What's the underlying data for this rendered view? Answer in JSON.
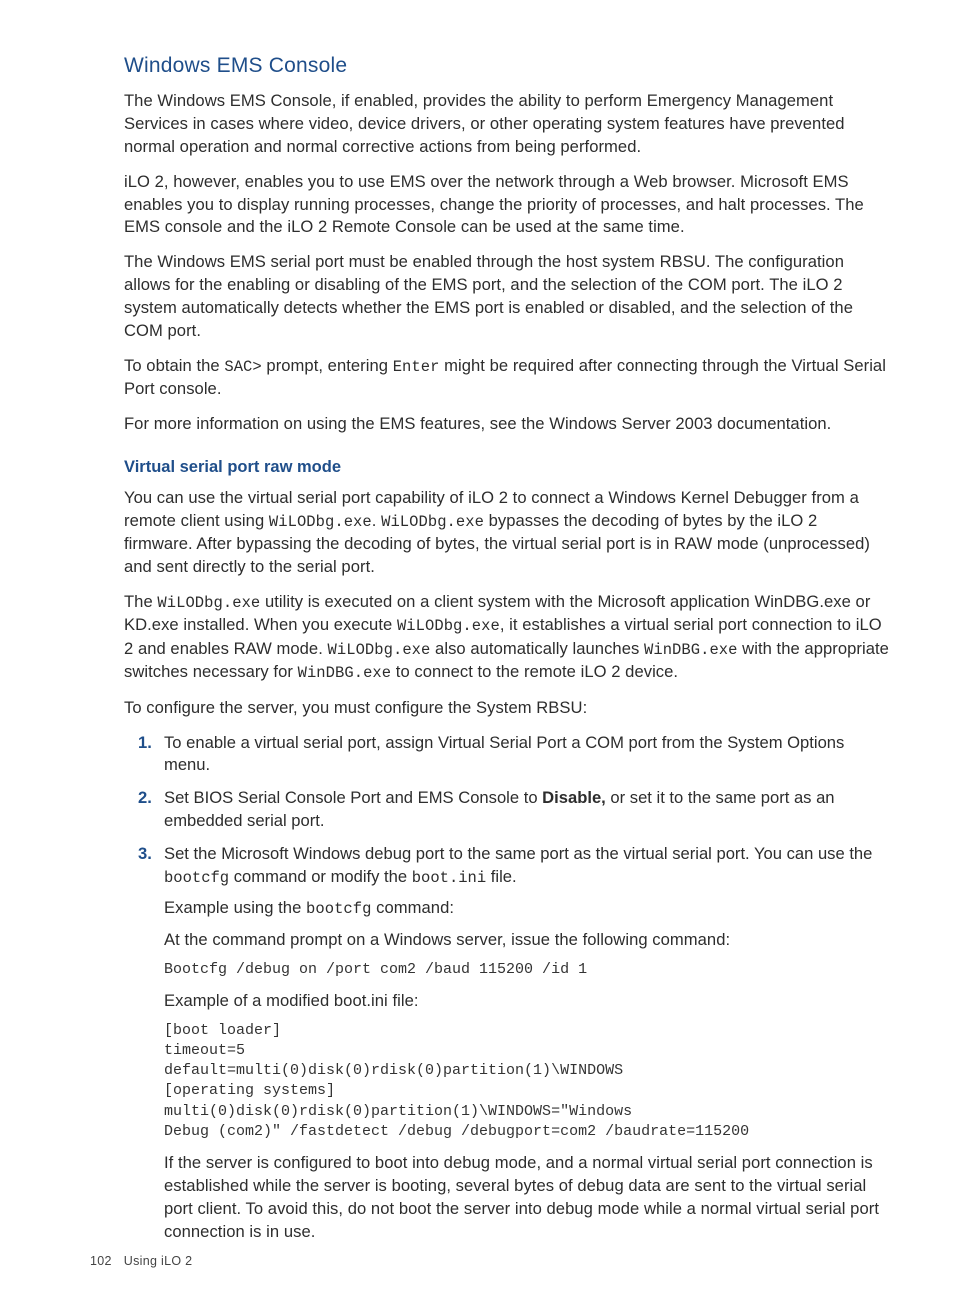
{
  "section_title": "Windows EMS Console",
  "para_ems_1": "The Windows EMS Console, if enabled, provides the ability to perform Emergency Management Services in cases where video, device drivers, or other operating system features have prevented normal operation and normal corrective actions from being performed.",
  "para_ems_2": "iLO 2, however, enables you to use EMS over the network through a Web browser. Microsoft EMS enables you to display running processes, change the priority of processes, and halt processes. The EMS console and the iLO 2 Remote Console can be used at the same time.",
  "para_ems_3": "The Windows EMS serial port must be enabled through the host system RBSU. The configuration allows for the enabling or disabling of the EMS port, and the selection of the COM port. The iLO 2 system automatically detects whether the EMS port is enabled or disabled, and the selection of the COM port.",
  "sac_pre": "To obtain the ",
  "sac_code": "SAC>",
  "sac_mid": " prompt, entering ",
  "sac_code2": "Enter",
  "sac_post": " might be required after connecting through the Virtual Serial Port console.",
  "para_ems_5": "For more information on using the EMS features, see the Windows Server 2003 documentation.",
  "sub_title": "Virtual serial port raw mode",
  "vsp1_pre": "You can use the virtual serial port capability of iLO 2 to connect a Windows Kernel Debugger from a remote client using ",
  "vsp1_c1": "WiLODbg.exe",
  "vsp1_mid": ". ",
  "vsp1_c2": "WiLODbg.exe",
  "vsp1_post": " bypasses the decoding of bytes by the iLO 2 firmware. After bypassing the decoding of bytes, the virtual serial port is in RAW mode (unprocessed) and sent directly to the serial port.",
  "vsp2_pre": "The ",
  "vsp2_c1": "WiLODbg.exe",
  "vsp2_mid1": " utility is executed on a client system with the Microsoft application WinDBG.exe or KD.exe installed. When you execute ",
  "vsp2_c2": "WiLODbg.exe",
  "vsp2_mid2": ", it establishes a virtual serial port connection to iLO 2 and enables RAW mode. ",
  "vsp2_c3": "WiLODbg.exe",
  "vsp2_mid3": " also automatically launches ",
  "vsp2_c4": "WinDBG.exe",
  "vsp2_mid4": " with the appropriate switches necessary for ",
  "vsp2_c5": "WinDBG.exe",
  "vsp2_post": " to connect to the remote iLO 2 device.",
  "vsp_config_intro": "To configure the server, you must configure the System RBSU:",
  "step1": "To enable a virtual serial port, assign Virtual Serial Port a COM port from the System Options menu.",
  "step2_pre": "Set BIOS Serial Console Port and EMS Console to ",
  "step2_bold": "Disable,",
  "step2_post": " or set it to the same port as an embedded serial port.",
  "step3_pre": "Set the Microsoft Windows debug port to the same port as the virtual serial port. You can use the ",
  "step3_c1": "bootcfg",
  "step3_mid": " command or modify the ",
  "step3_c2": "boot.ini",
  "step3_post": " file.",
  "ex_cmd_lead_pre": "Example using the ",
  "ex_cmd_lead_code": "bootcfg",
  "ex_cmd_lead_post": " command:",
  "ex_prompt_line": "At the command prompt on a Windows server, issue the following command:",
  "cmd_line": "Bootcfg /debug on /port com2 /baud 115200 /id 1",
  "ex_boot_lead": "Example of a modified boot.ini file:",
  "bootini": "[boot loader]\ntimeout=5\ndefault=multi(0)disk(0)rdisk(0)partition(1)\\WINDOWS\n[operating systems]\nmulti(0)disk(0)rdisk(0)partition(1)\\WINDOWS=\"Windows\nDebug (com2)\" /fastdetect /debug /debugport=com2 /baudrate=115200",
  "vsp_warn": "If the server is configured to boot into debug mode, and a normal virtual serial port connection is established while the server is booting, several bytes of debug data are sent to the virtual serial port client. To avoid this, do not boot the server into debug mode while a normal virtual serial port connection is in use.",
  "footer_page": "102",
  "footer_text": "Using iLO 2"
}
